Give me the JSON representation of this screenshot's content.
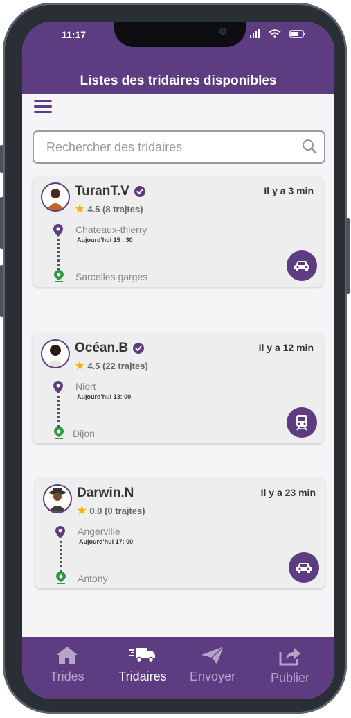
{
  "status_bar": {
    "time": "11:17"
  },
  "header": {
    "title": "Listes des tridaires disponibles"
  },
  "search": {
    "placeholder": "Rechercher des tridaires"
  },
  "cards": [
    {
      "name": "TuranT.V",
      "ago": "Il y a 3 min",
      "rating": "4.5 (8 trajtes)",
      "from": "Chateaux-thierry",
      "when": "Aujourd'hui 15 : 30",
      "to": "Sarcelles garges",
      "mode_icon": "car-icon"
    },
    {
      "name": "Océan.B",
      "ago": "Il y a 12 min",
      "rating": "4.5 (22 trajtes)",
      "from": "Niort",
      "when": "Aujourd'hui 13: 00",
      "to": "Dijon",
      "mode_icon": "train-icon"
    },
    {
      "name": "Darwin.N",
      "ago": "Il y a 23 min",
      "rating": "0.0 (0 trajtes)",
      "from": "Angerville",
      "when": "Aujourd'hui 17: 00",
      "to": "Antony",
      "mode_icon": "car-icon"
    }
  ],
  "nav": [
    {
      "label": "Trides",
      "icon": "home-icon",
      "active": false
    },
    {
      "label": "Tridaires",
      "icon": "truck-icon",
      "active": true
    },
    {
      "label": "Envoyer",
      "icon": "send-icon",
      "active": false
    },
    {
      "label": "Publier",
      "icon": "share-icon",
      "active": false
    }
  ],
  "colors": {
    "primary": "#5e3c82",
    "star": "#f7b500",
    "pin_from": "#5e3c82",
    "pin_to": "#2e9a3c"
  }
}
